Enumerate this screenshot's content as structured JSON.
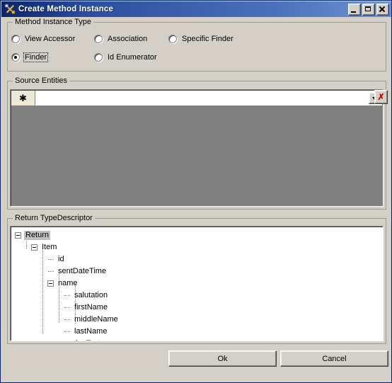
{
  "window": {
    "title": "Create Method Instance",
    "icon": "tools-icon",
    "controls": {
      "minimize": "Minimize",
      "maximize": "Maximize",
      "close": "Close"
    },
    "colors": {
      "title_gradient_start": "#0a246a",
      "title_gradient_end": "#6e93d4",
      "dialog_face": "#d4d0c8",
      "grid_backdrop": "#808080",
      "delete_red": "#d40000",
      "selection_gray": "#c0c0c0"
    }
  },
  "method_instance_type": {
    "legend": "Method Instance Type",
    "options": [
      {
        "label": "View Accessor",
        "checked": false,
        "focused": false
      },
      {
        "label": "Association",
        "checked": false,
        "focused": false
      },
      {
        "label": "Specific Finder",
        "checked": false,
        "focused": false
      },
      {
        "label": "Finder",
        "checked": true,
        "focused": true
      },
      {
        "label": "Id Enumerator",
        "checked": false,
        "focused": false
      }
    ],
    "selected": "Finder"
  },
  "source_entities": {
    "legend": "Source Entities",
    "new_row_indicator": "✱",
    "combo_value": "",
    "combo_placeholder": "",
    "dropdown_icon": "chevron-down-icon",
    "delete_label": "✗"
  },
  "return_type_descriptor": {
    "legend": "Return TypeDescriptor",
    "nodes": [
      {
        "label": "Return",
        "depth": 0,
        "expandable": true,
        "expanded": true,
        "selected": true
      },
      {
        "label": "Item",
        "depth": 1,
        "expandable": true,
        "expanded": true,
        "selected": false
      },
      {
        "label": "id",
        "depth": 2,
        "expandable": false,
        "expanded": false,
        "selected": false
      },
      {
        "label": "sentDateTime",
        "depth": 2,
        "expandable": false,
        "expanded": false,
        "selected": false
      },
      {
        "label": "name",
        "depth": 2,
        "expandable": true,
        "expanded": true,
        "selected": false
      },
      {
        "label": "salutation",
        "depth": 3,
        "expandable": false,
        "expanded": false,
        "selected": false
      },
      {
        "label": "firstName",
        "depth": 3,
        "expandable": false,
        "expanded": false,
        "selected": false
      },
      {
        "label": "middleName",
        "depth": 3,
        "expandable": false,
        "expanded": false,
        "selected": false
      },
      {
        "label": "lastName",
        "depth": 3,
        "expandable": false,
        "expanded": false,
        "selected": false
      },
      {
        "label": "greetingText",
        "depth": 2,
        "expandable": false,
        "expanded": false,
        "selected": false
      }
    ]
  },
  "footer": {
    "ok_label": "Ok",
    "cancel_label": "Cancel"
  }
}
